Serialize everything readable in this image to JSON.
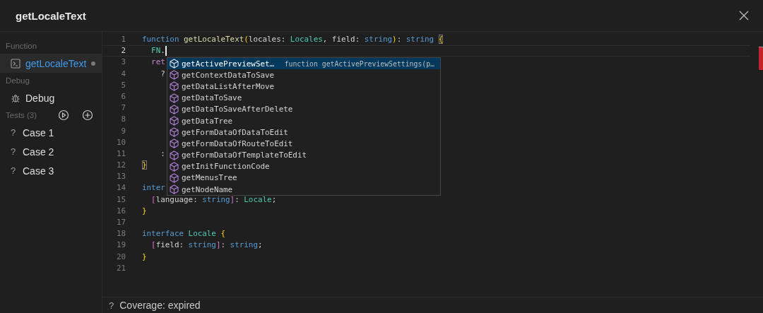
{
  "window": {
    "title": "getLocaleText"
  },
  "sidebar": {
    "sections": [
      {
        "heading": "Function",
        "kind": "plain",
        "items": [
          {
            "label": "getLocaleText",
            "kind": "function",
            "selected": true,
            "modified": true
          }
        ]
      },
      {
        "heading": "Debug",
        "kind": "plain",
        "items": [
          {
            "label": "Debug",
            "kind": "debug",
            "selected": false,
            "modified": false
          }
        ]
      },
      {
        "heading": "Tests (3)",
        "kind": "tests",
        "items": [
          {
            "label": "Case 1",
            "kind": "case",
            "marker": "?",
            "selected": false,
            "modified": false
          },
          {
            "label": "Case 2",
            "kind": "case",
            "marker": "?",
            "selected": false,
            "modified": false
          },
          {
            "label": "Case 3",
            "kind": "case",
            "marker": "?",
            "selected": false,
            "modified": false
          }
        ]
      }
    ]
  },
  "editor": {
    "lines": [
      {
        "number": "1",
        "current": false,
        "tokens": [
          {
            "kind": "kw",
            "text": "function"
          },
          {
            "kind": "fn",
            "text": " getLocaleText"
          },
          {
            "kind": "b1",
            "text": "("
          },
          {
            "kind": "plain",
            "text": "locales: "
          },
          {
            "kind": "type",
            "text": "Locales"
          },
          {
            "kind": "plain",
            "text": ", field: "
          },
          {
            "kind": "kw",
            "text": "string"
          },
          {
            "kind": "b1",
            "text": ")"
          },
          {
            "kind": "plain",
            "text": ": "
          },
          {
            "kind": "kw",
            "text": "string "
          },
          {
            "kind": "bm",
            "text": "{"
          }
        ]
      },
      {
        "number": "2",
        "current": true,
        "tokens": [
          {
            "kind": "type",
            "text": "  FN"
          },
          {
            "kind": "plain",
            "text": "."
          }
        ]
      },
      {
        "number": "3",
        "current": false,
        "tokens": [
          {
            "kind": "ctrl",
            "text": "  ret"
          }
        ]
      },
      {
        "number": "4",
        "current": false,
        "tokens": [
          {
            "kind": "plain",
            "text": "    ?"
          }
        ]
      },
      {
        "number": "5",
        "current": false
      },
      {
        "number": "6",
        "current": false
      },
      {
        "number": "7",
        "current": false
      },
      {
        "number": "8",
        "current": false
      },
      {
        "number": "9",
        "current": false
      },
      {
        "number": "10",
        "current": false
      },
      {
        "number": "11",
        "current": false,
        "tokens": [
          {
            "kind": "plain",
            "text": "    :"
          }
        ]
      },
      {
        "number": "12",
        "current": false,
        "tokens": [
          {
            "kind": "bm",
            "text": "}"
          }
        ]
      },
      {
        "number": "13",
        "current": false
      },
      {
        "number": "14",
        "current": false,
        "tokens": [
          {
            "kind": "kw",
            "text": "inter"
          }
        ]
      },
      {
        "number": "15",
        "current": false,
        "tokens": [
          {
            "kind": "b2",
            "text": "  ["
          },
          {
            "kind": "plain",
            "text": "language: "
          },
          {
            "kind": "kw",
            "text": "string"
          },
          {
            "kind": "b2",
            "text": "]"
          },
          {
            "kind": "plain",
            "text": ": "
          },
          {
            "kind": "type",
            "text": "Locale"
          },
          {
            "kind": "plain",
            "text": ";"
          }
        ]
      },
      {
        "number": "16",
        "current": false,
        "tokens": [
          {
            "kind": "b1",
            "text": "}"
          }
        ]
      },
      {
        "number": "17",
        "current": false
      },
      {
        "number": "18",
        "current": false,
        "tokens": [
          {
            "kind": "kw",
            "text": "interface"
          },
          {
            "kind": "type",
            "text": " Locale "
          },
          {
            "kind": "b1",
            "text": "{"
          }
        ]
      },
      {
        "number": "19",
        "current": false,
        "tokens": [
          {
            "kind": "b2",
            "text": "  ["
          },
          {
            "kind": "plain",
            "text": "field: "
          },
          {
            "kind": "kw",
            "text": "string"
          },
          {
            "kind": "b2",
            "text": "]"
          },
          {
            "kind": "plain",
            "text": ": "
          },
          {
            "kind": "kw",
            "text": "string"
          },
          {
            "kind": "plain",
            "text": ";"
          }
        ]
      },
      {
        "number": "20",
        "current": false,
        "tokens": [
          {
            "kind": "b1",
            "text": "}"
          }
        ]
      },
      {
        "number": "21",
        "current": false
      }
    ],
    "suggestions": [
      {
        "label": "getActivePreviewSet…",
        "selected": true,
        "detail": "function getActivePreviewSettings(p…"
      },
      {
        "label": "getContextDataToSave",
        "selected": false
      },
      {
        "label": "getDataListAfterMove",
        "selected": false
      },
      {
        "label": "getDataToSave",
        "selected": false
      },
      {
        "label": "getDataToSaveAfterDelete",
        "selected": false
      },
      {
        "label": "getDataTree",
        "selected": false
      },
      {
        "label": "getFormDataOfDataToEdit",
        "selected": false
      },
      {
        "label": "getFormDataOfRouteToEdit",
        "selected": false
      },
      {
        "label": "getFormDataOfTemplateToEdit",
        "selected": false
      },
      {
        "label": "getInitFunctionCode",
        "selected": false
      },
      {
        "label": "getMenusTree",
        "selected": false
      },
      {
        "label": "getNodeName",
        "selected": false
      }
    ]
  },
  "status_bar": {
    "icon": "?",
    "text": "Coverage: expired"
  }
}
